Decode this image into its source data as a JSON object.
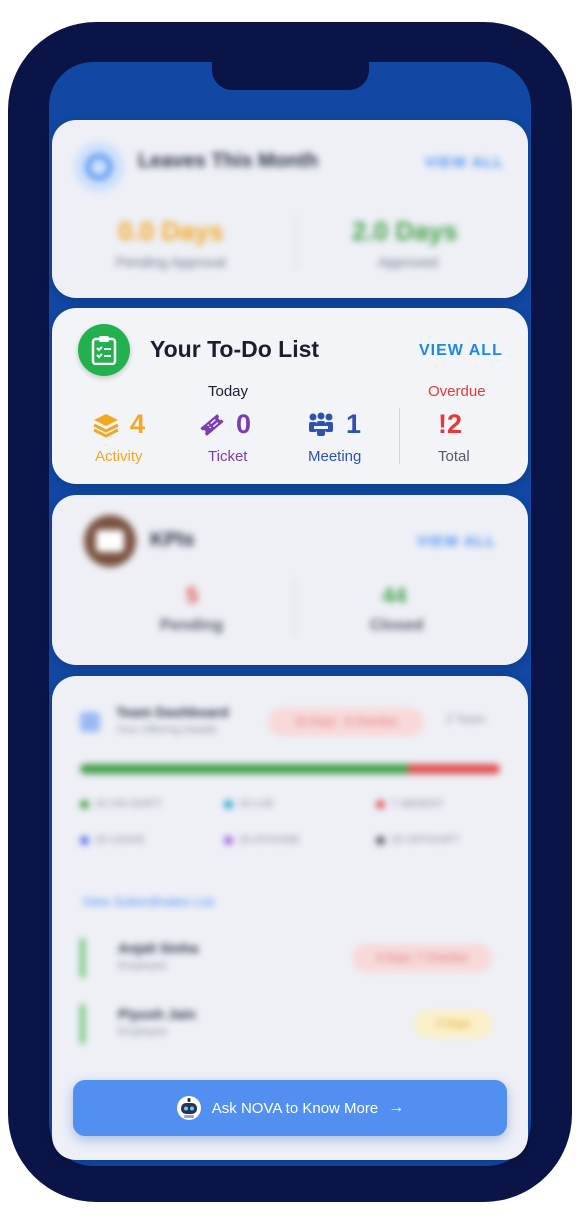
{
  "leaves": {
    "title": "Leaves This Month",
    "view_all": "VIEW ALL",
    "pending_value": "0.0 Days",
    "pending_label": "Pending Approval",
    "approved_value": "2.0 Days",
    "approved_label": "Approved"
  },
  "todo": {
    "title": "Your To-Do List",
    "view_all": "VIEW ALL",
    "today_label": "Today",
    "overdue_label": "Overdue",
    "activity_count": "4",
    "activity_label": "Activity",
    "ticket_count": "0",
    "ticket_label": "Ticket",
    "meeting_count": "1",
    "meeting_label": "Meeting",
    "overdue_value": "!2",
    "total_label": "Total",
    "colors": {
      "activity": "#f5a623",
      "ticket": "#7b3db0",
      "meeting": "#2e52b0",
      "overdue": "#e53935",
      "view_all": "#1e88e5",
      "icon_bg": "#22b14c"
    }
  },
  "kpis": {
    "title": "KPIs",
    "view_all": "VIEW ALL",
    "pending_value": "5",
    "pending_label": "Pending",
    "closed_value": "44",
    "closed_label": "Closed"
  },
  "dashboard": {
    "title": "Team Dashboard",
    "subtitle": "Your Offering Details",
    "pill": "20 Days · 8 Overdue",
    "right": "2 Team",
    "legend": [
      "20 ON-SHIFT",
      "20 LVE",
      "7 ABSENT",
      "20 LEAVE",
      "20 ATHOME",
      "20 OFFSHIFT"
    ],
    "link": "View Subordinates List",
    "rows": [
      {
        "name": "Anjali Sinha",
        "role": "Employee",
        "tag": "4 Days, 7 Overdue"
      },
      {
        "name": "Piyush Jain",
        "role": "Employee",
        "tag": "4 Days"
      }
    ]
  },
  "nova": {
    "label": "Ask NOVA to Know More",
    "arrow": "→"
  }
}
